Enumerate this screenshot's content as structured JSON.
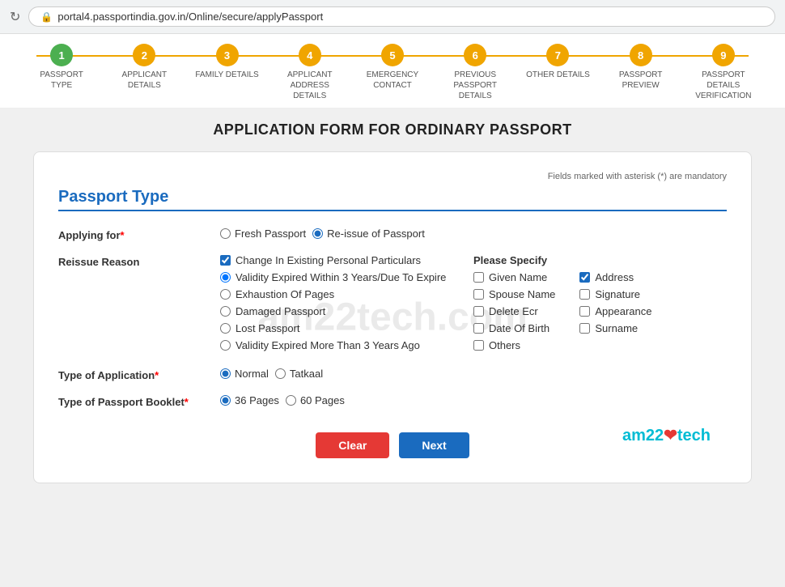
{
  "browser": {
    "reload_icon": "↻",
    "lock_icon": "🔒",
    "url": "portal4.passportindia.gov.in/Online/secure/applyPassport"
  },
  "stepper": {
    "steps": [
      {
        "number": "1",
        "label": "PASSPORT TYPE",
        "active": true
      },
      {
        "number": "2",
        "label": "APPLICANT DETAILS",
        "active": false
      },
      {
        "number": "3",
        "label": "FAMILY DETAILS",
        "active": false
      },
      {
        "number": "4",
        "label": "APPLICANT ADDRESS DETAILS",
        "active": false
      },
      {
        "number": "5",
        "label": "EMERGENCY CONTACT",
        "active": false
      },
      {
        "number": "6",
        "label": "PREVIOUS PASSPORT DETAILS",
        "active": false
      },
      {
        "number": "7",
        "label": "OTHER DETAILS",
        "active": false
      },
      {
        "number": "8",
        "label": "PASSPORT PREVIEW",
        "active": false
      },
      {
        "number": "9",
        "label": "PASSPORT DETAILS VERIFICATION",
        "active": false
      }
    ]
  },
  "page": {
    "title": "APPLICATION FORM FOR ORDINARY PASSPORT"
  },
  "form": {
    "mandatory_note": "Fields marked with asterisk (*) are mandatory",
    "section_title": "Passport Type",
    "applying_for_label": "Applying for*",
    "applying_for_options": [
      {
        "id": "fresh",
        "label": "Fresh Passport",
        "checked": false
      },
      {
        "id": "reissue",
        "label": "Re-issue of Passport",
        "checked": true
      }
    ],
    "reissue_reason_label": "Reissue Reason",
    "reissue_reasons": [
      {
        "label": "Change In Existing Personal Particulars",
        "checked": true,
        "type": "checkbox"
      },
      {
        "label": "Validity Expired Within 3 Years/Due To Expire",
        "checked": true,
        "type": "radio"
      },
      {
        "label": "Exhaustion Of Pages",
        "checked": false,
        "type": "radio"
      },
      {
        "label": "Damaged Passport",
        "checked": false,
        "type": "radio"
      },
      {
        "label": "Lost Passport",
        "checked": false,
        "type": "radio"
      },
      {
        "label": "Validity Expired More Than 3 Years Ago",
        "checked": false,
        "type": "radio"
      }
    ],
    "please_specify_label": "Please Specify",
    "specify_col1": [
      {
        "label": "Given Name",
        "checked": false
      },
      {
        "label": "Spouse Name",
        "checked": false
      },
      {
        "label": "Delete Ecr",
        "checked": false
      },
      {
        "label": "Date Of Birth",
        "checked": false
      },
      {
        "label": "Others",
        "checked": false
      }
    ],
    "specify_col2": [
      {
        "label": "Address",
        "checked": true
      },
      {
        "label": "Signature",
        "checked": false
      },
      {
        "label": "Appearance",
        "checked": false
      },
      {
        "label": "Surname",
        "checked": false
      }
    ],
    "application_type_label": "Type of Application*",
    "application_type_options": [
      {
        "id": "normal",
        "label": "Normal",
        "checked": true
      },
      {
        "id": "tatkaal",
        "label": "Tatkaal",
        "checked": false
      }
    ],
    "passport_booklet_label": "Type of Passport Booklet*",
    "passport_booklet_options": [
      {
        "id": "36pages",
        "label": "36 Pages",
        "checked": true
      },
      {
        "id": "60pages",
        "label": "60 Pages",
        "checked": false
      }
    ],
    "clear_button": "Clear",
    "next_button": "Next",
    "watermark": "am22tech.com",
    "branding": "am22",
    "branding_heart": "❤",
    "branding_end": "tech"
  }
}
